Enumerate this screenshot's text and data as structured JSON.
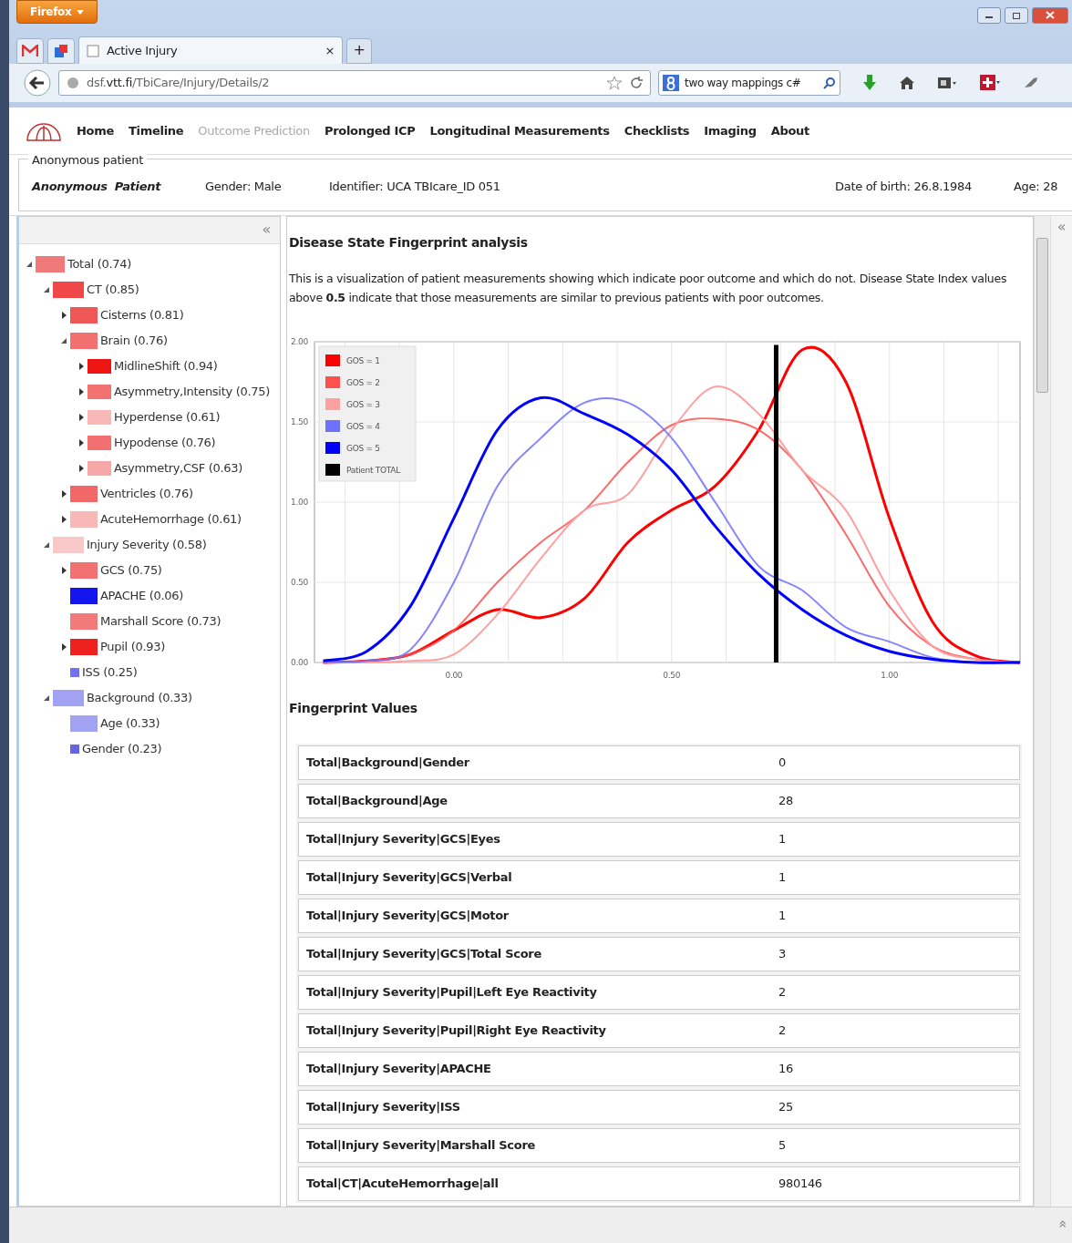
{
  "browser": {
    "app_button": "Firefox",
    "tabs": [
      {
        "title": "Active Injury",
        "close": "×",
        "selected": true
      }
    ],
    "new_tab": "+",
    "url": "dsf.**vtt.fi**/TbiCare/Injury/Details/2",
    "search": "two way mappings c#"
  },
  "nav": [
    {
      "label": "Home",
      "disabled": false
    },
    {
      "label": "Timeline",
      "disabled": false
    },
    {
      "label": "Outcome Prediction",
      "disabled": true
    },
    {
      "label": "Prolonged ICP",
      "disabled": false
    },
    {
      "label": "Longitudinal Measurements",
      "disabled": false
    },
    {
      "label": "Checklists",
      "disabled": false
    },
    {
      "label": "Imaging",
      "disabled": false
    },
    {
      "label": "About",
      "disabled": false
    }
  ],
  "patient": {
    "legend": "Anonymous patient",
    "first_name": "Anonymous",
    "last_name": "Patient",
    "gender": "Gender: Male",
    "identifier": "Identifier: UCA TBIcare_ID 051",
    "birth": "Date of birth: 26.8.1984",
    "age": "Age: 28"
  },
  "sidebar": {
    "collapse": "«",
    "tree": [
      {
        "label": "Total (0.74)",
        "color": "#f07a7a",
        "kind": "branch",
        "expanded": true,
        "children": [
          {
            "label": "CT (0.85)",
            "color": "#f04848",
            "kind": "branch",
            "expanded": true,
            "children": [
              {
                "label": "Cisterns (0.81)",
                "color": "#f05858",
                "kind": "branch",
                "expanded": false
              },
              {
                "label": "Brain (0.76)",
                "color": "#f27070",
                "kind": "branch",
                "expanded": true,
                "children": [
                  {
                    "label": "MidlineShift (0.94)",
                    "color": "#ee1515",
                    "kind": "branch",
                    "expanded": false
                  },
                  {
                    "label": "Asymmetry,Intensity (0.75)",
                    "color": "#f27272",
                    "kind": "branch",
                    "expanded": false
                  },
                  {
                    "label": "Hyperdense (0.61)",
                    "color": "#f8b8b8",
                    "kind": "branch",
                    "expanded": false
                  },
                  {
                    "label": "Hypodense (0.76)",
                    "color": "#f27070",
                    "kind": "branch",
                    "expanded": false
                  },
                  {
                    "label": "Asymmetry,CSF (0.63)",
                    "color": "#f6a8a8",
                    "kind": "branch",
                    "expanded": false
                  }
                ]
              },
              {
                "label": "Ventricles (0.76)",
                "color": "#f26868",
                "kind": "branch",
                "expanded": false
              },
              {
                "label": "AcuteHemorrhage (0.61)",
                "color": "#f8b8b8",
                "kind": "branch",
                "expanded": false
              }
            ]
          },
          {
            "label": "Injury Severity (0.58)",
            "color": "#f9c8c8",
            "kind": "branch",
            "expanded": true,
            "children": [
              {
                "label": "GCS (0.75)",
                "color": "#f27272",
                "kind": "branch",
                "expanded": false
              },
              {
                "label": "APACHE (0.06)",
                "color": "#1414ee",
                "kind": "leaf"
              },
              {
                "label": "Marshall Score (0.73)",
                "color": "#f27a7a",
                "kind": "leaf"
              },
              {
                "label": "Pupil (0.93)",
                "color": "#ee2020",
                "kind": "branch",
                "expanded": false
              },
              {
                "label": "ISS (0.25)",
                "color": "#7272ee",
                "kind": "dot"
              }
            ]
          },
          {
            "label": "Background (0.33)",
            "color": "#a2a2f2",
            "kind": "branch",
            "expanded": true,
            "children": [
              {
                "label": "Age (0.33)",
                "color": "#a2a2f2",
                "kind": "leaf"
              },
              {
                "label": "Gender (0.23)",
                "color": "#6464e4",
                "kind": "dot"
              }
            ]
          }
        ]
      }
    ]
  },
  "main": {
    "title": "Disease State Fingerprint analysis",
    "description": "This is a visualization of patient measurements showing which indicate poor outcome and which do not. Disease State Index values above **0.5** indicate that those measurements are similar to previous patients with poor outcomes.",
    "chart_data": {
      "type": "line",
      "grid": true,
      "legend": true,
      "x": [
        -0.3,
        -0.2,
        -0.1,
        0,
        0.1,
        0.2,
        0.3,
        0.4,
        0.5,
        0.6,
        0.7,
        0.8,
        0.9,
        1.0,
        1.1,
        1.2,
        1.3
      ],
      "xlim": [
        -0.32,
        1.3
      ],
      "ylim": [
        0,
        2
      ],
      "xticks": [
        {
          "value": 0,
          "label": "0.00"
        },
        {
          "value": 0.5,
          "label": "0.50"
        },
        {
          "value": 1,
          "label": "1.00"
        }
      ],
      "yticks": [
        {
          "value": 0,
          "label": "0.00"
        },
        {
          "value": 0.5,
          "label": "0.50"
        },
        {
          "value": 1,
          "label": "1.00"
        },
        {
          "value": 1.5,
          "label": "1.50"
        },
        {
          "value": 2,
          "label": "2.00"
        }
      ],
      "series": [
        {
          "name": "GOS = 1",
          "color": "#ff0000",
          "values": [
            0,
            0.01,
            0.05,
            0.2,
            0.33,
            0.28,
            0.4,
            0.75,
            0.95,
            1.1,
            1.45,
            1.95,
            1.75,
            0.9,
            0.25,
            0.04,
            0
          ]
        },
        {
          "name": "GOS = 2",
          "color": "#ff5050",
          "values": [
            0,
            0.01,
            0.05,
            0.2,
            0.5,
            0.75,
            0.95,
            1.25,
            1.48,
            1.52,
            1.45,
            1.2,
            0.8,
            0.35,
            0.1,
            0.02,
            0
          ]
        },
        {
          "name": "GOS = 3",
          "color": "#ffa0a0",
          "values": [
            0,
            0,
            0.01,
            0.05,
            0.3,
            0.65,
            0.95,
            1.05,
            1.45,
            1.72,
            1.55,
            1.2,
            0.95,
            0.45,
            0.1,
            0.02,
            0
          ]
        },
        {
          "name": "GOS = 4",
          "color": "#7070ff",
          "values": [
            0,
            0.01,
            0.08,
            0.5,
            1.1,
            1.4,
            1.62,
            1.62,
            1.4,
            1.0,
            0.6,
            0.45,
            0.22,
            0.13,
            0.03,
            0,
            0
          ]
        },
        {
          "name": "GOS = 5",
          "color": "#0000ff",
          "values": [
            0.01,
            0.07,
            0.35,
            0.9,
            1.45,
            1.65,
            1.55,
            1.42,
            1.2,
            0.85,
            0.55,
            0.33,
            0.17,
            0.07,
            0.02,
            0,
            0
          ]
        },
        {
          "name": "Patient TOTAL",
          "color": "#000000",
          "x": [
            0.74,
            0.74
          ],
          "values": [
            0,
            1.98
          ]
        }
      ]
    },
    "values_title": "Fingerprint Values",
    "rows": [
      {
        "name": "Total|Background|Gender",
        "value": "0"
      },
      {
        "name": "Total|Background|Age",
        "value": "28"
      },
      {
        "name": "Total|Injury Severity|GCS|Eyes",
        "value": "1"
      },
      {
        "name": "Total|Injury Severity|GCS|Verbal",
        "value": "1"
      },
      {
        "name": "Total|Injury Severity|GCS|Motor",
        "value": "1"
      },
      {
        "name": "Total|Injury Severity|GCS|Total Score",
        "value": "3"
      },
      {
        "name": "Total|Injury Severity|Pupil|Left Eye Reactivity",
        "value": "2"
      },
      {
        "name": "Total|Injury Severity|Pupil|Right Eye Reactivity",
        "value": "2"
      },
      {
        "name": "Total|Injury Severity|APACHE",
        "value": "16"
      },
      {
        "name": "Total|Injury Severity|ISS",
        "value": "25"
      },
      {
        "name": "Total|Injury Severity|Marshall Score",
        "value": "5"
      },
      {
        "name": "Total|CT|AcuteHemorrhage|all",
        "value": "980146"
      }
    ]
  },
  "right_panel": {
    "expand": "«"
  },
  "status_bar": {
    "expand": "«"
  }
}
